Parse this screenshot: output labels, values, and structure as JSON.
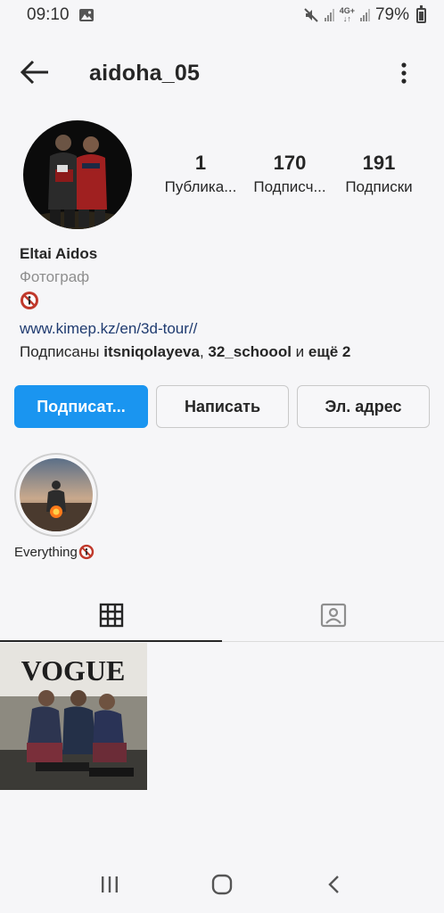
{
  "status_bar": {
    "time": "09:10",
    "battery": "79%",
    "network": "4G+"
  },
  "header": {
    "username": "aidoha_05"
  },
  "stats": [
    {
      "count": "1",
      "label": "Публика..."
    },
    {
      "count": "170",
      "label": "Подписч..."
    },
    {
      "count": "191",
      "label": "Подписки"
    }
  ],
  "bio": {
    "name": "Eltai Aidos",
    "category": "Фотограф",
    "link": "www.kimep.kz/en/3d-tour//",
    "followed_prefix": "Подписаны ",
    "followed_user1": "itsniqolayeva",
    "followed_sep": ", ",
    "followed_user2": "32_schoool",
    "followed_and": " и ",
    "followed_more": "ещё 2"
  },
  "buttons": {
    "follow": "Подписат...",
    "message": "Написать",
    "email": "Эл. адрес"
  },
  "highlight": {
    "label": "Everything"
  },
  "post": {
    "magazine_title": "VOGUE"
  },
  "colors": {
    "accent": "#1a95f0",
    "link": "#1f3b70",
    "muted": "#8e8e8e",
    "badge_red": "#c0392b"
  },
  "icons": {
    "back": "arrow-left-icon",
    "more": "more-vertical-icon",
    "grid": "grid-icon",
    "tagged": "tagged-person-icon",
    "no_entry": "no-entry-icon",
    "nav_recent": "recent-apps-icon",
    "nav_home": "home-icon",
    "nav_back": "back-chevron-icon"
  }
}
